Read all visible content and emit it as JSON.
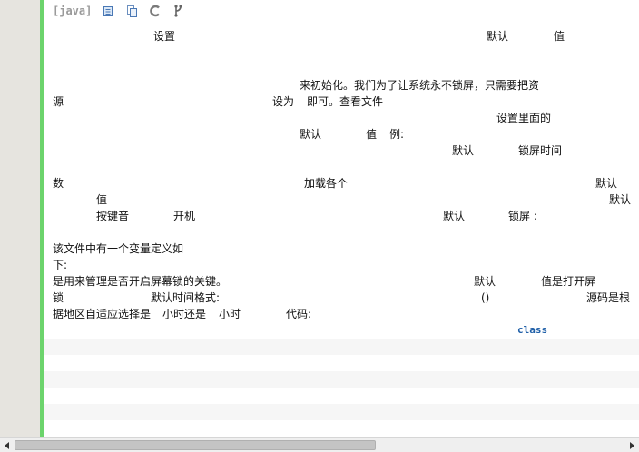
{
  "toolbar": {
    "language": "[java]",
    "icons": [
      "view-source-icon",
      "copy-icon",
      "print-icon",
      "about-icon"
    ]
  },
  "content": {
    "l1a": "设置",
    "l1b": "默认",
    "l1c": "值",
    "l2": "来初始化。我们为了让系统永不锁屏，只需要把资",
    "l3a": "源",
    "l3b": "设为",
    "l3c": "即可。查看文件",
    "l4": "设置里面的",
    "l5a": "默认",
    "l5b": "值",
    "l5c": "例:",
    "l6a": "默认",
    "l6b": "锁屏时间",
    "l7a": "数",
    "l7b": "加载各个",
    "l7c": "默认",
    "l8a": "值",
    "l8b": "默认",
    "l9a": "按键音",
    "l9b": "开机",
    "l9c": "默认",
    "l9d": "锁屏 :",
    "l10": "该文件中有一个变量定义如",
    "l11": "下:",
    "l12a": "是用来管理是否开启屏幕锁的关键。",
    "l12b": "默认",
    "l12c": "值是打开屏",
    "l13a": "锁",
    "l13b": "默认时间格式:",
    "l13c": "()",
    "l13d": "源码是根",
    "l14a": "据地区自适应选择是",
    "l14b": "小时还是",
    "l14c": "小时",
    "l14d": "代码:",
    "code_keyword": "class"
  }
}
